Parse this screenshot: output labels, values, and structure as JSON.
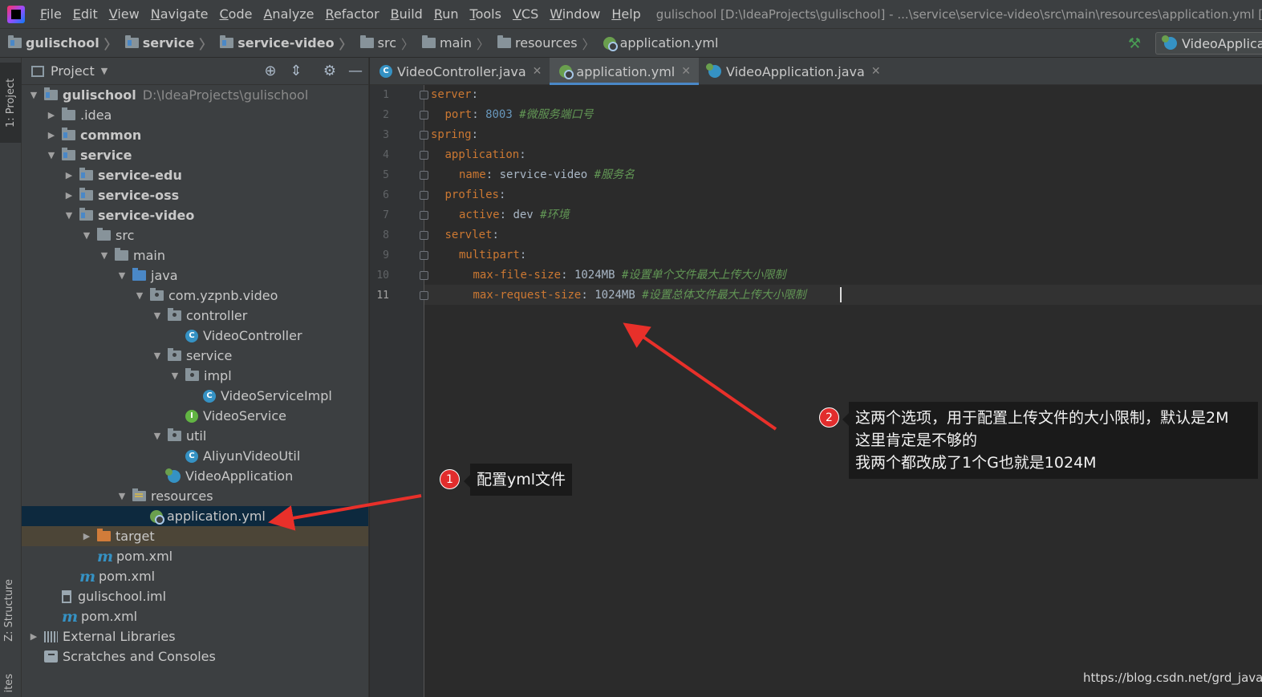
{
  "menubar": {
    "items": [
      "File",
      "Edit",
      "View",
      "Navigate",
      "Code",
      "Analyze",
      "Refactor",
      "Build",
      "Run",
      "Tools",
      "VCS",
      "Window",
      "Help"
    ],
    "title": "gulischool [D:\\IdeaProjects\\gulischool] - ...\\service\\service-video\\src\\main\\resources\\application.yml [servic"
  },
  "breadcrumb": [
    "gulischool",
    "service",
    "service-video",
    "src",
    "main",
    "resources",
    "application.yml"
  ],
  "run_config": "VideoApplica",
  "left_stripe": {
    "project_tab": "1: Project",
    "structure_tab": "Z: Structure",
    "favorites_tab": "ites"
  },
  "project_panel": {
    "title": "Project",
    "root_path": "D:\\IdeaProjects\\gulischool",
    "tree": [
      {
        "label": "gulischool",
        "arrow": "down",
        "icon": "module-folder",
        "bold": true
      },
      {
        "label": ".idea",
        "arrow": "right",
        "icon": "folder"
      },
      {
        "label": "common",
        "arrow": "right",
        "icon": "module-folder",
        "bold": true
      },
      {
        "label": "service",
        "arrow": "down",
        "icon": "module-folder",
        "bold": true
      },
      {
        "label": "service-edu",
        "arrow": "right",
        "icon": "module-folder",
        "bold": true
      },
      {
        "label": "service-oss",
        "arrow": "right",
        "icon": "module-folder",
        "bold": true
      },
      {
        "label": "service-video",
        "arrow": "down",
        "icon": "module-folder",
        "bold": true
      },
      {
        "label": "src",
        "arrow": "down",
        "icon": "folder"
      },
      {
        "label": "main",
        "arrow": "down",
        "icon": "folder"
      },
      {
        "label": "java",
        "arrow": "down",
        "icon": "source-folder"
      },
      {
        "label": "com.yzpnb.video",
        "arrow": "down",
        "icon": "package"
      },
      {
        "label": "controller",
        "arrow": "down",
        "icon": "package"
      },
      {
        "label": "VideoController",
        "arrow": "none",
        "icon": "class"
      },
      {
        "label": "service",
        "arrow": "down",
        "icon": "package"
      },
      {
        "label": "impl",
        "arrow": "down",
        "icon": "package"
      },
      {
        "label": "VideoServiceImpl",
        "arrow": "none",
        "icon": "class"
      },
      {
        "label": "VideoService",
        "arrow": "none",
        "icon": "interface"
      },
      {
        "label": "util",
        "arrow": "down",
        "icon": "package"
      },
      {
        "label": "AliyunVideoUtil",
        "arrow": "none",
        "icon": "class"
      },
      {
        "label": "VideoApplication",
        "arrow": "none",
        "icon": "spring-class"
      },
      {
        "label": "resources",
        "arrow": "down",
        "icon": "resources-folder"
      },
      {
        "label": "application.yml",
        "arrow": "none",
        "icon": "yml",
        "selected": true
      },
      {
        "label": "target",
        "arrow": "right",
        "icon": "target-folder",
        "excluded": true
      },
      {
        "label": "pom.xml",
        "arrow": "none",
        "icon": "maven"
      },
      {
        "label": "pom.xml",
        "arrow": "none",
        "icon": "maven"
      },
      {
        "label": "gulischool.iml",
        "arrow": "none",
        "icon": "iml"
      },
      {
        "label": "pom.xml",
        "arrow": "none",
        "icon": "maven"
      },
      {
        "label": "External Libraries",
        "arrow": "right",
        "icon": "libraries"
      },
      {
        "label": "Scratches and Consoles",
        "arrow": "none",
        "icon": "scratches"
      }
    ]
  },
  "editor_tabs": [
    {
      "label": "VideoController.java",
      "icon": "class",
      "active": false
    },
    {
      "label": "application.yml",
      "icon": "yml",
      "active": true
    },
    {
      "label": "VideoApplication.java",
      "icon": "spring-class",
      "active": false
    }
  ],
  "editor": {
    "current_line": 11,
    "lines": [
      {
        "n": "1",
        "key": "server",
        "sep": ":",
        "value": "",
        "comment": ""
      },
      {
        "n": "2",
        "key": "port",
        "sep": ": ",
        "value": "8003",
        "comment": "#微服务端口号"
      },
      {
        "n": "3",
        "key": "spring",
        "sep": ":",
        "value": "",
        "comment": ""
      },
      {
        "n": "4",
        "key": "application",
        "sep": ":",
        "value": "",
        "comment": ""
      },
      {
        "n": "5",
        "key": "name",
        "sep": ": ",
        "value": "service-video",
        "comment": "#服务名"
      },
      {
        "n": "6",
        "key": "profiles",
        "sep": ":",
        "value": "",
        "comment": ""
      },
      {
        "n": "7",
        "key": "active",
        "sep": ": ",
        "value": "dev",
        "comment": "#环境"
      },
      {
        "n": "8",
        "key": "servlet",
        "sep": ":",
        "value": "",
        "comment": ""
      },
      {
        "n": "9",
        "key": "multipart",
        "sep": ":",
        "value": "",
        "comment": ""
      },
      {
        "n": "10",
        "key": "max-file-size",
        "sep": ": ",
        "value": "1024MB",
        "comment": "#设置单个文件最大上传大小限制"
      },
      {
        "n": "11",
        "key": "max-request-size",
        "sep": ": ",
        "value": "1024MB",
        "comment": "#设置总体文件最大上传大小限制"
      }
    ]
  },
  "annotations": [
    {
      "number": "1",
      "text": "配置yml文件"
    },
    {
      "number": "2",
      "lines": [
        "这两个选项，用于配置上传文件的大小限制，默认是2M",
        "这里肯定是不够的",
        "我两个都改成了1个G也就是1024M"
      ]
    }
  ],
  "watermark": "https://blog.csdn.net/grd_java",
  "colors": {
    "arrow": "#e8302a",
    "annotation_badge": "#e22d2d",
    "selection": "#0d293e",
    "key": "#cc7832",
    "number": "#6897bb",
    "comment": "#629755"
  }
}
